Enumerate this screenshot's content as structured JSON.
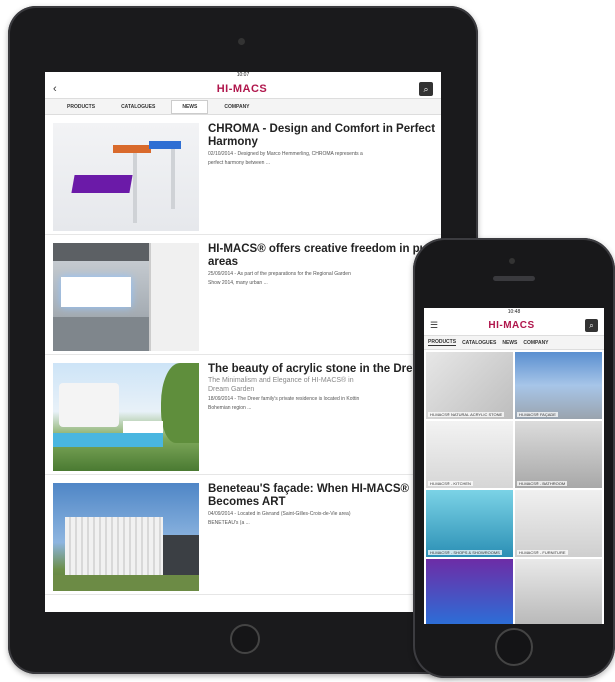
{
  "tablet": {
    "status_time": "10:07",
    "logo": "HI-MACS",
    "tabs": [
      {
        "label": "PRODUCTS"
      },
      {
        "label": "CATALOGUES"
      },
      {
        "label": "NEWS"
      },
      {
        "label": "COMPANY"
      }
    ],
    "news": [
      {
        "title1": "CHROMA - Design and Comfort in Perfect",
        "title2": "Harmony",
        "sub": "",
        "meta1": "02/10/2014 - Designed by Marco Hemmerling, CHROMA represents a",
        "meta2": "perfect harmony between ..."
      },
      {
        "title1": "HI-MACS® offers creative freedom in publ",
        "title2": "areas",
        "sub": "",
        "meta1": "25/09/2014 - As part of the preparations for the Regional Garden",
        "meta2": "Show 2014, many urban ..."
      },
      {
        "title1": "The beauty of acrylic stone in the Dreer ho",
        "title2": "",
        "sub": "The Minimalism and Elegance of HI-MACS® in",
        "sub2": "Dream Garden",
        "meta1": "18/09/2014 - The Dreer family's private residence is located in Kottin",
        "meta2": "Bohemian region ..."
      },
      {
        "title1": "Beneteau'S façade: When HI-MACS®",
        "title2": "Becomes ART",
        "sub": "",
        "meta1": "04/09/2014 - Located in Givrand (Saint-Gilles-Croix-de-Vie area)",
        "meta2": "BENETEAU's (a ..."
      }
    ]
  },
  "phone": {
    "status_time": "10:48",
    "logo": "HI-MACS",
    "tabs": [
      {
        "label": "PRODUCTS"
      },
      {
        "label": "CATALOGUES"
      },
      {
        "label": "NEWS"
      },
      {
        "label": "COMPANY"
      }
    ],
    "tiles": [
      {
        "caption": "HI-MACS® NATURAL ACRYLIC STONE"
      },
      {
        "caption": "HI-MACS® FAÇADE"
      },
      {
        "caption": "HI-MACS® - KITCHEN"
      },
      {
        "caption": "HI-MACS® - BATHROOM"
      },
      {
        "caption": "HI-MACS® - SHOPS & SHOWROOMS"
      },
      {
        "caption": "HI-MACS® - FURNITURE"
      },
      {
        "caption": ""
      },
      {
        "caption": ""
      }
    ]
  }
}
